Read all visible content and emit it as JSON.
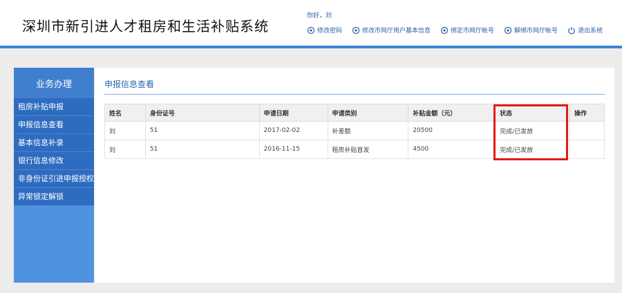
{
  "header": {
    "title": "深圳市新引进人才租房和生活补贴系统",
    "greeting": "你好，刘",
    "links": [
      {
        "label": "修改密码",
        "icon": "gear-icon"
      },
      {
        "label": "修改市网厅用户基本信息",
        "icon": "gear-icon"
      },
      {
        "label": "绑定市网厅帐号",
        "icon": "gear-icon"
      },
      {
        "label": "解绑市网厅帐号",
        "icon": "gear-icon"
      },
      {
        "label": "退出系统",
        "icon": "power-icon"
      }
    ]
  },
  "sidebar": {
    "heading": "业务办理",
    "items": [
      {
        "label": "租房补贴申报"
      },
      {
        "label": "申报信息查看"
      },
      {
        "label": "基本信息补录"
      },
      {
        "label": "银行信息修改"
      },
      {
        "label": "非身份证引进申报授权"
      },
      {
        "label": "异常锁定解锁"
      }
    ]
  },
  "main": {
    "title": "申报信息查看",
    "columns": [
      "姓名",
      "身份证号",
      "申请日期",
      "申请类别",
      "补贴金额（元）",
      "状态",
      "操作"
    ],
    "rows": [
      {
        "name": "刘",
        "id_no": "51",
        "date": "2017-02-02",
        "category": "补差额",
        "amount": "20500",
        "status": "完成/已发放",
        "action": ""
      },
      {
        "name": "刘",
        "id_no": "51",
        "date": "2016-11-15",
        "category": "租房补贴首发",
        "amount": "4500",
        "status": "完成/已发放",
        "action": ""
      }
    ]
  },
  "colors": {
    "header_bar": "#3c86d8",
    "sidebar_bg": "#4f93df",
    "sidebar_item": "#2e6cc0",
    "highlight": "#e01b1b"
  }
}
